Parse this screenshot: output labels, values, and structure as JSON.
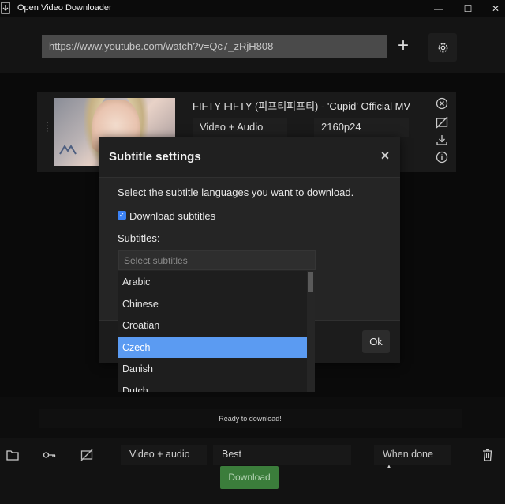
{
  "window": {
    "title": "Open Video Downloader",
    "minimize": "—",
    "maximize": "☐",
    "close": "✕"
  },
  "toolbar": {
    "url_value": "https://www.youtube.com/watch?v=Qc7_zRjH808",
    "add_label": "+"
  },
  "video_card": {
    "title": "FIFTY FIFTY (피프티피프티) - 'Cupid' Official MV",
    "format": "Video + Audio",
    "quality": "2160p24"
  },
  "subtitle_modal": {
    "title": "Subtitle settings",
    "close": "×",
    "instruction": "Select the subtitle languages you want to download.",
    "download_label": "Download subtitles",
    "download_checked": true,
    "subtitles_label": "Subtitles:",
    "placeholder": "Select subtitles",
    "ok_label": "Ok",
    "options": [
      "Arabic",
      "Chinese",
      "Croatian",
      "Czech",
      "Danish",
      "Dutch"
    ],
    "selected_option": "Czech"
  },
  "status": {
    "text": "Ready to download!"
  },
  "bottom_bar": {
    "format": "Video + audio",
    "quality": "Best",
    "when_done": "When done",
    "download_label": "Download"
  },
  "colors": {
    "accent_blue": "#5b9bf2",
    "download_green": "#3b7d3b",
    "input_gray": "#4a4a4a"
  }
}
